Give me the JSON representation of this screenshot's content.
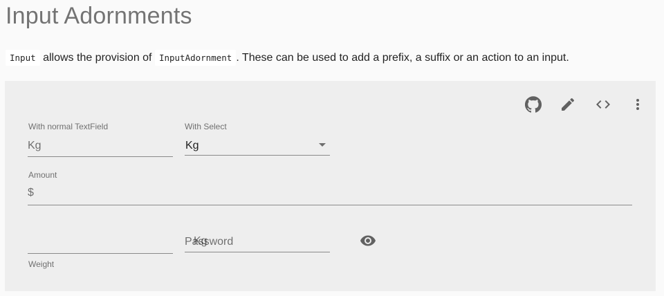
{
  "page": {
    "title": "Input Adornments",
    "intro": {
      "code1": "Input",
      "text1": " allows the provision of ",
      "code2": "InputAdornment",
      "text2": ". These can be used to add a prefix, a suffix or an action to an input."
    }
  },
  "toolbar": {
    "icons": [
      "github-icon",
      "edit-icon",
      "code-icon",
      "more-vert-icon"
    ]
  },
  "form": {
    "normal_textfield": {
      "label": "With normal TextField",
      "adornment": "Kg",
      "value": ""
    },
    "with_select": {
      "label": "With Select",
      "value": "Kg"
    },
    "amount": {
      "label": "Amount",
      "adornment": "$",
      "value": ""
    },
    "weight": {
      "helper": "Weight",
      "adornment": "Kg",
      "value": ""
    },
    "password": {
      "placeholder": "Password",
      "value": ""
    }
  },
  "colors": {
    "background": "#fafafa",
    "demo_background": "#eeeeee",
    "icon": "#616161"
  }
}
